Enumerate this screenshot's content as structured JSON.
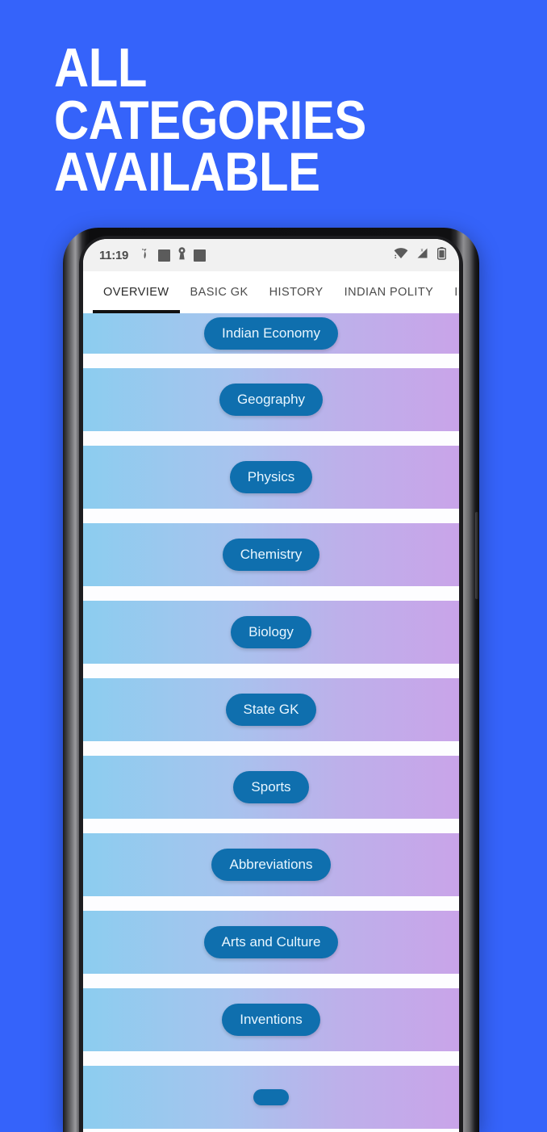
{
  "promo": {
    "headline": "ALL CATEGORIES\nAVAILABLE",
    "background_color": "#3563fa",
    "text_color": "#ffffff"
  },
  "phone": {
    "bezel_color": "#111113",
    "side_button": "power-button"
  },
  "status_bar": {
    "time": "11:19",
    "left_icons": [
      "call-forwarding-icon",
      "notification-square-icon",
      "key-icon",
      "notification-square-icon"
    ],
    "right_icons": [
      "wifi-icon",
      "no-sim-signal-icon",
      "battery-icon"
    ],
    "background_color": "#f1f1f1"
  },
  "tabs": {
    "active_index": 0,
    "indicator_color": "#111111",
    "items": [
      {
        "label": "OVERVIEW"
      },
      {
        "label": "BASIC GK"
      },
      {
        "label": "HISTORY"
      },
      {
        "label": "INDIAN POLITY"
      },
      {
        "label": "INDIA"
      }
    ]
  },
  "categories": {
    "row_gradient_from": "#8ccdef",
    "row_gradient_to": "#c9a4e9",
    "pill_color": "#0f6fae",
    "pill_text_color": "#e8f6ff",
    "items": [
      {
        "label": "Indian Economy",
        "clipped": true
      },
      {
        "label": "Geography",
        "clipped": false
      },
      {
        "label": "Physics",
        "clipped": false
      },
      {
        "label": "Chemistry",
        "clipped": false
      },
      {
        "label": "Biology",
        "clipped": false
      },
      {
        "label": "State GK",
        "clipped": false
      },
      {
        "label": "Sports",
        "clipped": false
      },
      {
        "label": "Abbreviations",
        "clipped": false
      },
      {
        "label": "Arts and Culture",
        "clipped": false
      },
      {
        "label": "Inventions",
        "clipped": false
      },
      {
        "label": "",
        "clipped": true
      }
    ]
  }
}
